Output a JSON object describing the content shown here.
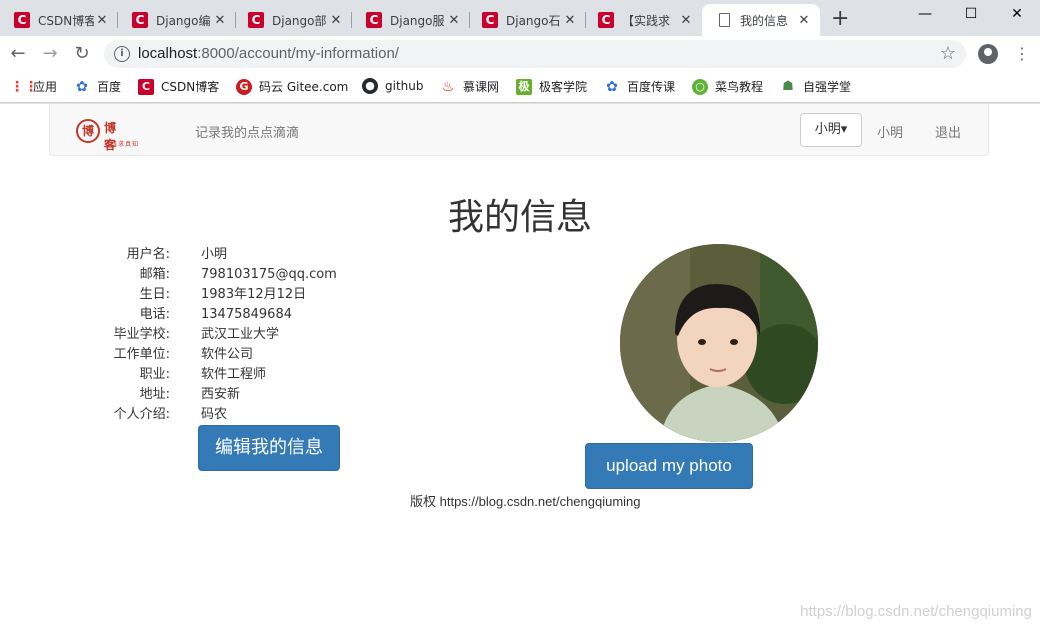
{
  "browser": {
    "tabs": [
      {
        "title": "CSDN博客"
      },
      {
        "title": "Django编"
      },
      {
        "title": "Django部"
      },
      {
        "title": "Django服"
      },
      {
        "title": "Django石"
      },
      {
        "title": "【实践求"
      },
      {
        "title": "我的信息"
      }
    ],
    "close_glyph": "✕",
    "new_tab": "+",
    "url_host": "localhost",
    "url_path": ":8000/account/my-information/",
    "bookmarks": [
      {
        "label": "应用",
        "color": "#e94235"
      },
      {
        "label": "百度",
        "color": "#2f6fd6"
      },
      {
        "label": "CSDN博客",
        "color": "#c9002b"
      },
      {
        "label": "码云 Gitee.com",
        "color": "#c71d23"
      },
      {
        "label": "github",
        "color": "#24292e"
      },
      {
        "label": "慕课网",
        "color": "#f20d0d"
      },
      {
        "label": "极客学院",
        "color": "#6aae2e"
      },
      {
        "label": "百度传课",
        "color": "#2f6fd6"
      },
      {
        "label": "菜鸟教程",
        "color": "#5fb336"
      },
      {
        "label": "自强学堂",
        "color": "#4a8a4a"
      }
    ]
  },
  "navbar": {
    "logo_text": "博客",
    "logo_seal": "博",
    "logo_sub": "实践求真知",
    "tagline": "记录我的点点滴滴",
    "user_dropdown": "小明▾",
    "user_link": "小明",
    "logout": "退出"
  },
  "page": {
    "title": "我的信息",
    "fields": [
      {
        "label": "用户名:",
        "value": "小明"
      },
      {
        "label": "邮箱:",
        "value": "798103175@qq.com"
      },
      {
        "label": "生日:",
        "value": "1983年12月12日"
      },
      {
        "label": "电话:",
        "value": "13475849684"
      },
      {
        "label": "毕业学校:",
        "value": "武汉工业大学"
      },
      {
        "label": "工作单位:",
        "value": "软件公司"
      },
      {
        "label": "职业:",
        "value": "软件工程师"
      },
      {
        "label": "地址:",
        "value": "西安新"
      },
      {
        "label": "个人介绍:",
        "value": "码农"
      }
    ],
    "edit_button": "编辑我的信息",
    "upload_button": "upload my photo",
    "copyright": "版权 https://blog.csdn.net/chengqiuming"
  },
  "watermark": "https://blog.csdn.net/chengqiuming"
}
